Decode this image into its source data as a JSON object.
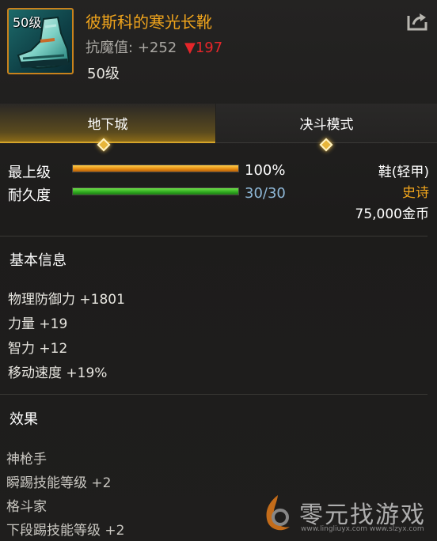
{
  "item": {
    "icon_level": "50级",
    "name": "彼斯科的寒光长靴",
    "resist_label": "抗魔值:",
    "resist_value": "+252",
    "resist_down": "▼197",
    "level": "50级",
    "icon": "boot-icon"
  },
  "share_icon": "share-icon",
  "tabs": [
    {
      "label": "地下城",
      "active": true
    },
    {
      "label": "决斗模式",
      "active": false
    }
  ],
  "stats": {
    "top_level": {
      "label": "最上级",
      "value": "100%",
      "fill": 1.0
    },
    "durability": {
      "label": "耐久度",
      "value": "30/30",
      "fill": 1.0
    }
  },
  "info": {
    "type": "鞋(轻甲)",
    "rarity": "史诗",
    "price": "75,000金币"
  },
  "basic": {
    "title": "基本信息",
    "attrs": [
      "物理防御力 +1801",
      "力量 +19",
      "智力 +12",
      "移动速度 +19%"
    ]
  },
  "effects": {
    "title": "效果",
    "lines": [
      "神枪手",
      "瞬踢技能等级 +2",
      "格斗家",
      "下段踢技能等级 +2"
    ]
  },
  "watermark": {
    "text": "零元找游戏",
    "url": "www.lingliuyx.com  www.slzyx.com"
  },
  "colors": {
    "accent": "#f0a41c",
    "danger": "#e5262a",
    "bar_orange": "#e58a10",
    "bar_green": "#2fa81f"
  }
}
